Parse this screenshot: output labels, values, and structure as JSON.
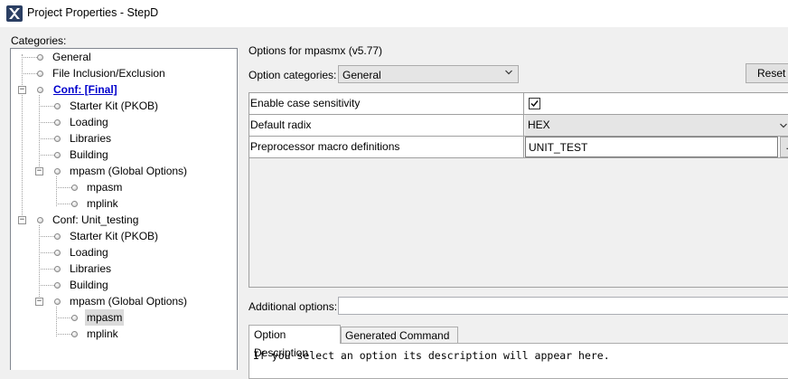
{
  "window": {
    "title": "Project Properties - StepD"
  },
  "categories_label": "Categories:",
  "tree": [
    {
      "label": "General"
    },
    {
      "label": "File Inclusion/Exclusion"
    },
    {
      "label": "Conf: [Final]",
      "toggle": "−"
    },
    {
      "label": "Starter Kit (PKOB)"
    },
    {
      "label": "Loading"
    },
    {
      "label": "Libraries"
    },
    {
      "label": "Building"
    },
    {
      "label": "mpasm (Global Options)",
      "toggle": "−"
    },
    {
      "label": "mpasm"
    },
    {
      "label": "mplink"
    },
    {
      "label": "Conf: Unit_testing",
      "toggle": "−"
    },
    {
      "label": "Starter Kit (PKOB)"
    },
    {
      "label": "Loading"
    },
    {
      "label": "Libraries"
    },
    {
      "label": "Building"
    },
    {
      "label": "mpasm (Global Options)",
      "toggle": "−"
    },
    {
      "label": "mpasm"
    },
    {
      "label": "mplink"
    }
  ],
  "options_title": "Options for mpasmx (v5.77)",
  "option_categories": {
    "label": "Option categories:",
    "value": "General"
  },
  "reset_label": "Reset",
  "option_rows": {
    "case": {
      "name": "Enable case sensitivity",
      "checked": true
    },
    "radix": {
      "name": "Default radix",
      "value": "HEX"
    },
    "macro": {
      "name": "Preprocessor macro definitions",
      "value": "UNIT_TEST",
      "button": "..."
    }
  },
  "additional_options": {
    "label": "Additional options:",
    "value": ""
  },
  "tabs": {
    "description": "Option Description",
    "command": "Generated Command Line"
  },
  "description_text": "If you select an option its description will appear here."
}
